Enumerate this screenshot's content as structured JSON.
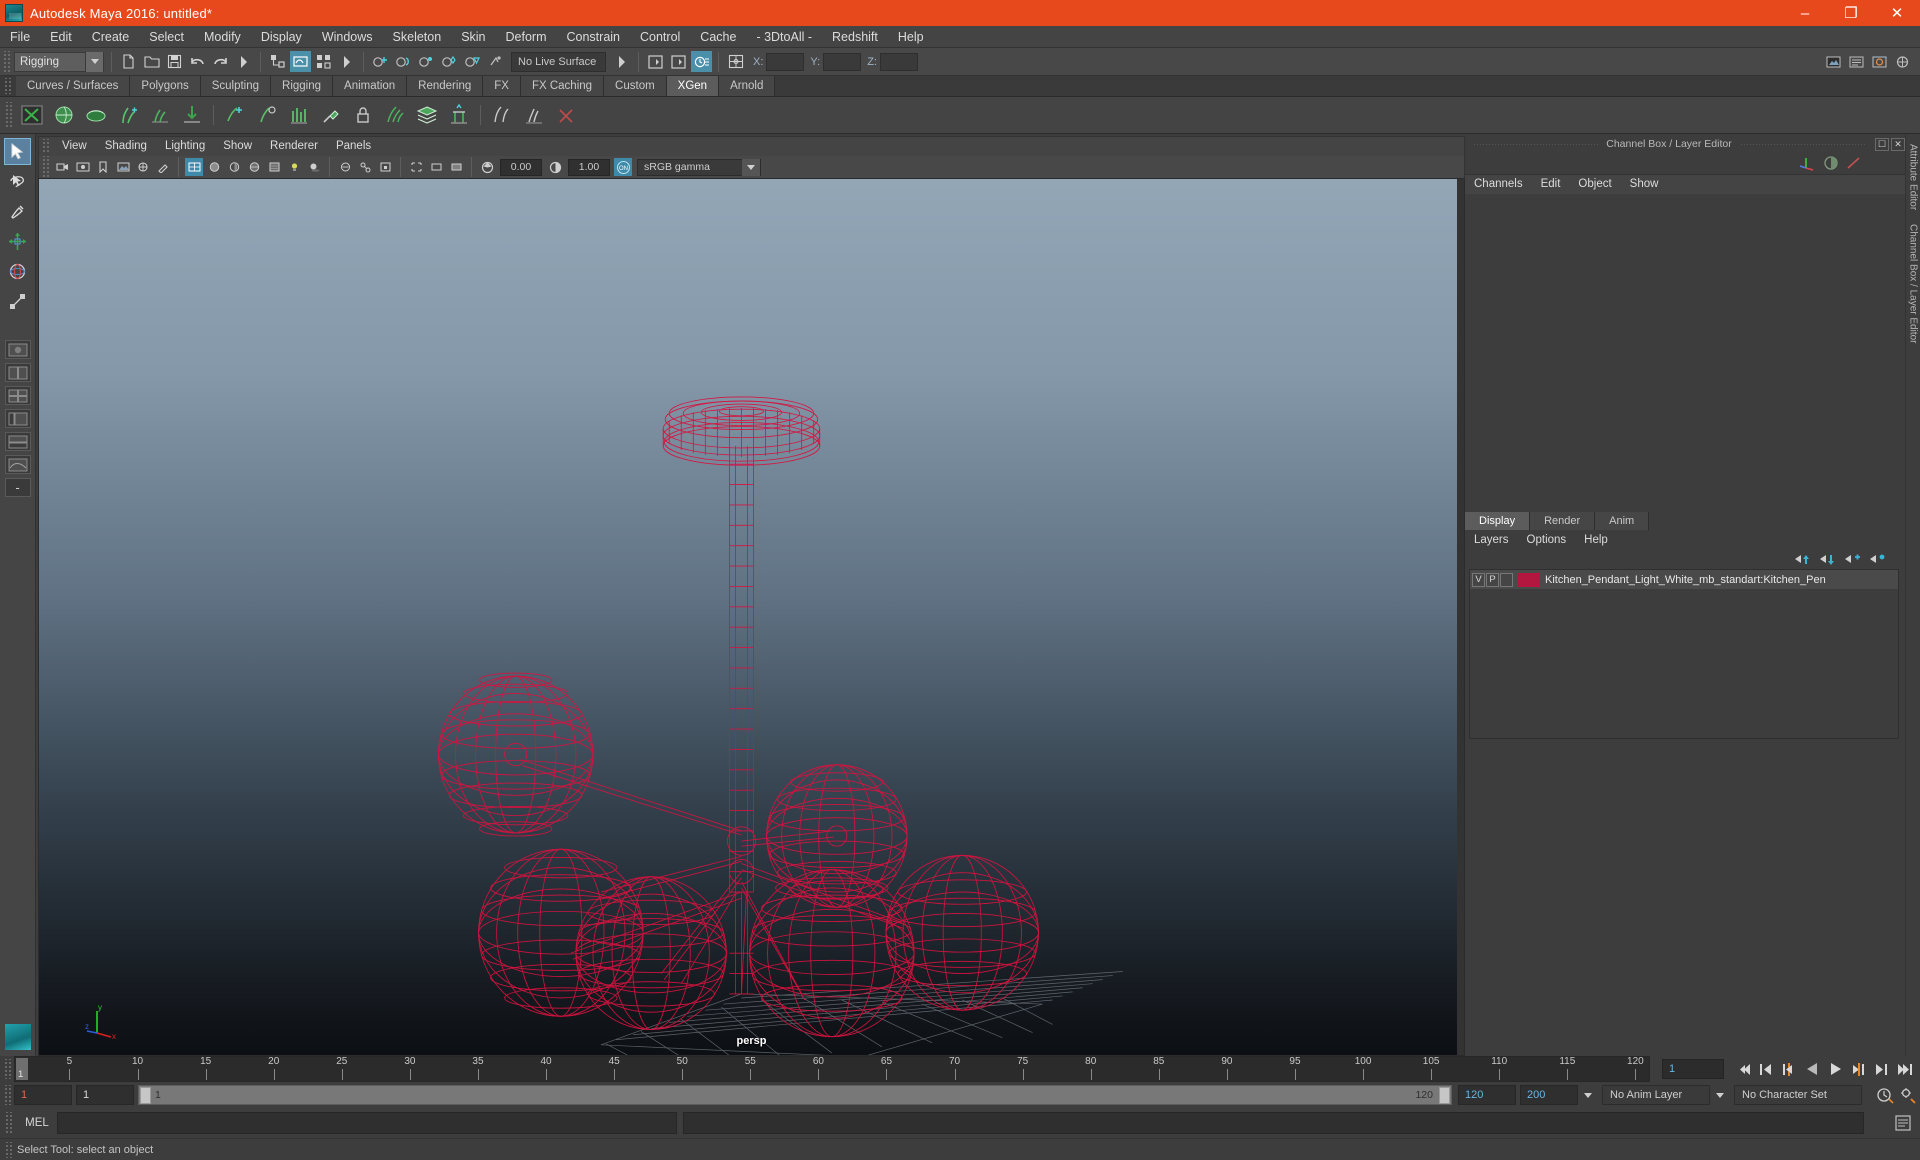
{
  "window": {
    "title": "Autodesk Maya 2016: untitled*",
    "minimize": "–",
    "maximize": "❐",
    "close": "✕"
  },
  "menubar": {
    "items": [
      {
        "label": "File"
      },
      {
        "label": "Edit"
      },
      {
        "label": "Create"
      },
      {
        "label": "Select"
      },
      {
        "label": "Modify"
      },
      {
        "label": "Display"
      },
      {
        "label": "Windows"
      },
      {
        "label": "Skeleton"
      },
      {
        "label": "Skin"
      },
      {
        "label": "Deform"
      },
      {
        "label": "Constrain"
      },
      {
        "label": "Control"
      },
      {
        "label": "Cache"
      },
      {
        "label": "- 3DtoAll -"
      },
      {
        "label": "Redshift"
      },
      {
        "label": "Help"
      }
    ]
  },
  "statusline": {
    "mode_selector": "Rigging",
    "live_surface": "No Live Surface",
    "coord_x_label": "X:",
    "coord_y_label": "Y:",
    "coord_z_label": "Z:",
    "coord_x_value": "",
    "coord_y_value": "",
    "coord_z_value": ""
  },
  "shelf": {
    "tabs": [
      {
        "label": "Curves / Surfaces",
        "active": false
      },
      {
        "label": "Polygons",
        "active": false
      },
      {
        "label": "Sculpting",
        "active": false
      },
      {
        "label": "Rigging",
        "active": false
      },
      {
        "label": "Animation",
        "active": false
      },
      {
        "label": "Rendering",
        "active": false
      },
      {
        "label": "FX",
        "active": false
      },
      {
        "label": "FX Caching",
        "active": false
      },
      {
        "label": "Custom",
        "active": false
      },
      {
        "label": "XGen",
        "active": true
      },
      {
        "label": "Arnold",
        "active": false
      }
    ]
  },
  "viewport": {
    "menus": [
      {
        "label": "View"
      },
      {
        "label": "Shading"
      },
      {
        "label": "Lighting"
      },
      {
        "label": "Show"
      },
      {
        "label": "Renderer"
      },
      {
        "label": "Panels"
      }
    ],
    "exposure_value": "0.00",
    "gamma_value": "1.00",
    "color_management_toggle": "ON",
    "color_profile": "sRGB gamma",
    "camera_label": "persp",
    "axis_x": "x",
    "axis_y": "y",
    "axis_z": "z",
    "model_color": "#d8123f"
  },
  "channelbox": {
    "panel_title": "Channel Box / Layer Editor",
    "menus": [
      {
        "label": "Channels"
      },
      {
        "label": "Edit"
      },
      {
        "label": "Object"
      },
      {
        "label": "Show"
      }
    ]
  },
  "layereditor": {
    "tabs": [
      {
        "label": "Display",
        "active": true
      },
      {
        "label": "Render",
        "active": false
      },
      {
        "label": "Anim",
        "active": false
      }
    ],
    "menus": [
      {
        "label": "Layers"
      },
      {
        "label": "Options"
      },
      {
        "label": "Help"
      }
    ],
    "layers": [
      {
        "visibility": "V",
        "playback": "P",
        "color": "#b3173f",
        "name": "Kitchen_Pendant_Light_White_mb_standart:Kitchen_Pen"
      }
    ]
  },
  "rails": {
    "attribute_editor": "Attribute Editor",
    "channel_box": "Channel Box / Layer Editor"
  },
  "timeline": {
    "start_label": "1",
    "ticks": [
      {
        "value": "5",
        "pos": 5
      },
      {
        "value": "10",
        "pos": 10
      },
      {
        "value": "15",
        "pos": 15
      },
      {
        "value": "20",
        "pos": 20
      },
      {
        "value": "25",
        "pos": 25
      },
      {
        "value": "30",
        "pos": 30
      },
      {
        "value": "35",
        "pos": 35
      },
      {
        "value": "40",
        "pos": 40
      },
      {
        "value": "45",
        "pos": 45
      },
      {
        "value": "50",
        "pos": 50
      },
      {
        "value": "55",
        "pos": 55
      },
      {
        "value": "60",
        "pos": 60
      },
      {
        "value": "65",
        "pos": 65
      },
      {
        "value": "70",
        "pos": 70
      },
      {
        "value": "75",
        "pos": 75
      },
      {
        "value": "80",
        "pos": 80
      },
      {
        "value": "85",
        "pos": 85
      },
      {
        "value": "90",
        "pos": 90
      },
      {
        "value": "95",
        "pos": 95
      },
      {
        "value": "100",
        "pos": 100
      },
      {
        "value": "105",
        "pos": 105
      },
      {
        "value": "110",
        "pos": 110
      },
      {
        "value": "115",
        "pos": 115
      },
      {
        "value": "120",
        "pos": 120
      }
    ],
    "current_frame": "1",
    "range_start": "1",
    "range_start2": "1",
    "slider_left": "1",
    "slider_right": "120",
    "range_end": "120",
    "playback_end": "200",
    "anim_layer": "No Anim Layer",
    "character_set": "No Character Set"
  },
  "commandline": {
    "language": "MEL",
    "input_value": "",
    "output_value": ""
  },
  "helpline": {
    "message": "Select Tool: select an object"
  }
}
